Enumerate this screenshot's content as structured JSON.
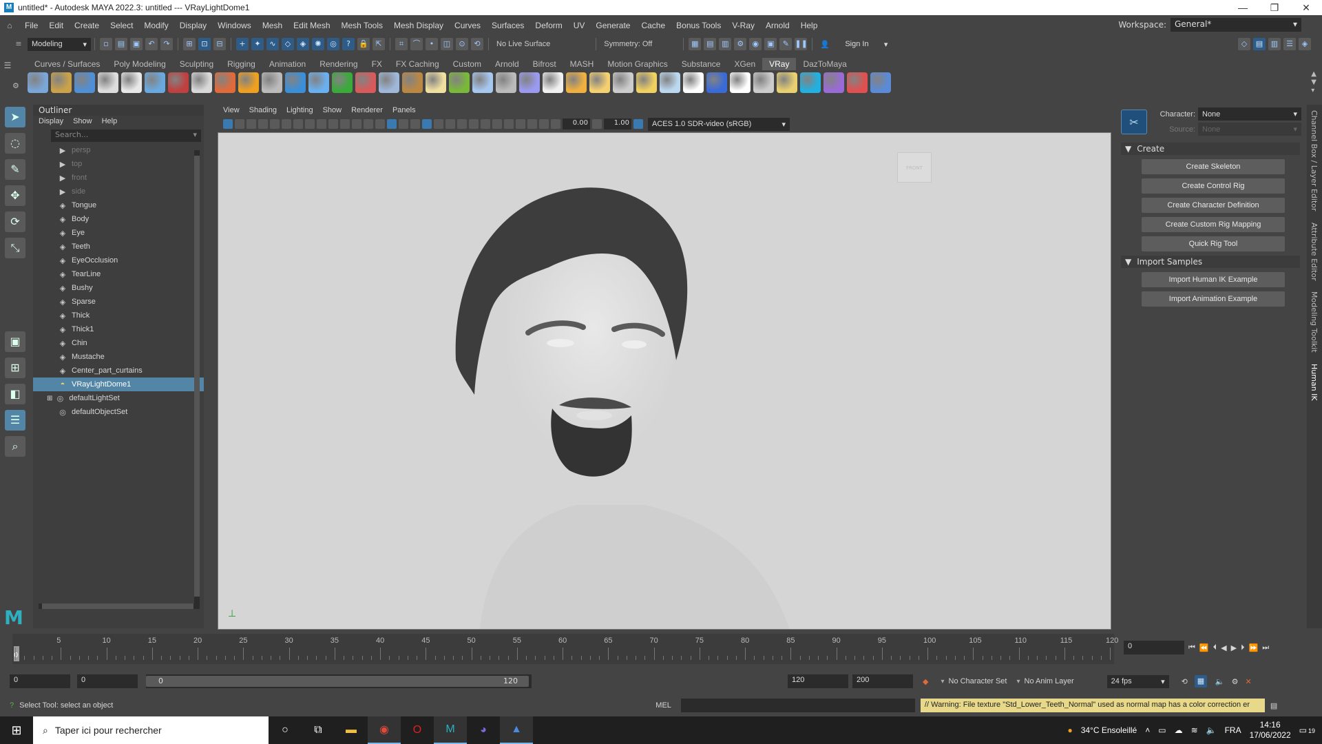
{
  "window": {
    "title": "untitled* - Autodesk MAYA 2022.3: untitled   ---   VRayLightDome1",
    "controls": [
      "—",
      "❐",
      "✕"
    ]
  },
  "menubar": {
    "items": [
      "File",
      "Edit",
      "Create",
      "Select",
      "Modify",
      "Display",
      "Windows",
      "Mesh",
      "Edit Mesh",
      "Mesh Tools",
      "Mesh Display",
      "Curves",
      "Surfaces",
      "Deform",
      "UV",
      "Generate",
      "Cache",
      "Bonus Tools",
      "V-Ray",
      "Arnold",
      "Help"
    ]
  },
  "workspace": {
    "label": "Workspace:",
    "value": "General*"
  },
  "statusline": {
    "mode": "Modeling",
    "live_surface": "No Live Surface",
    "symmetry": "Symmetry: Off",
    "sign_in": "Sign In"
  },
  "shelf": {
    "tabs": [
      "Curves / Surfaces",
      "Poly Modeling",
      "Sculpting",
      "Rigging",
      "Animation",
      "Rendering",
      "FX",
      "FX Caching",
      "Custom",
      "Arnold",
      "Bifrost",
      "MASH",
      "Motion Graphics",
      "Substance",
      "XGen",
      "VRay",
      "DazToMaya"
    ],
    "active_tab": "VRay",
    "icon_colors": [
      "#7aa6d8",
      "#c9a24a",
      "#4f8fd6",
      "#dddddd",
      "#e8e8e8",
      "#6aa9e0",
      "#c04040",
      "#d8d8d8",
      "#e06a3a",
      "#f0a020",
      "#bbbbbb",
      "#3b8fd8",
      "#6ab0f0",
      "#3aaa3a",
      "#d85a5a",
      "#9fb7d8",
      "#bb8844",
      "#f0e0a0",
      "#7ab83a",
      "#a6c8f0",
      "#bbbbbb",
      "#9a9af0",
      "#f0f0f0",
      "#f0b040",
      "#f5d070",
      "#cccccc",
      "#f0d060",
      "#bcd8f0",
      "#ffffff",
      "#3a6ad8",
      "#ffffff",
      "#cccccc",
      "#e8d070",
      "#22b0e0",
      "#9a6ad8",
      "#e05050",
      "#5a8ad8"
    ]
  },
  "outliner": {
    "title": "Outliner",
    "menu": [
      "Display",
      "Show",
      "Help"
    ],
    "search_placeholder": "Search...",
    "items": [
      {
        "label": "persp",
        "icon": "camera-icon",
        "dim": true
      },
      {
        "label": "top",
        "icon": "camera-icon",
        "dim": true
      },
      {
        "label": "front",
        "icon": "camera-icon",
        "dim": true
      },
      {
        "label": "side",
        "icon": "camera-icon",
        "dim": true
      },
      {
        "label": "Tongue",
        "icon": "mesh-icon"
      },
      {
        "label": "Body",
        "icon": "mesh-icon"
      },
      {
        "label": "Eye",
        "icon": "mesh-icon"
      },
      {
        "label": "Teeth",
        "icon": "mesh-icon"
      },
      {
        "label": "EyeOcclusion",
        "icon": "mesh-icon"
      },
      {
        "label": "TearLine",
        "icon": "mesh-icon"
      },
      {
        "label": "Bushy",
        "icon": "mesh-icon"
      },
      {
        "label": "Sparse",
        "icon": "mesh-icon"
      },
      {
        "label": "Thick",
        "icon": "mesh-icon"
      },
      {
        "label": "Thick1",
        "icon": "mesh-icon"
      },
      {
        "label": "Chin",
        "icon": "mesh-icon"
      },
      {
        "label": "Mustache",
        "icon": "mesh-icon"
      },
      {
        "label": "Center_part_curtains",
        "icon": "mesh-icon"
      },
      {
        "label": "VRayLightDome1",
        "icon": "dome-light-icon",
        "selected": true
      },
      {
        "label": "defaultLightSet",
        "icon": "set-icon"
      },
      {
        "label": "defaultObjectSet",
        "icon": "set-icon"
      }
    ]
  },
  "viewport": {
    "menu": [
      "View",
      "Shading",
      "Lighting",
      "Show",
      "Renderer",
      "Panels"
    ],
    "exposure": "0.00",
    "gamma": "1.00",
    "color_space": "ACES 1.0 SDR-video (sRGB)",
    "viewcube_label": "FRONT",
    "bg_color": "#d5d5d5"
  },
  "hik": {
    "character_label": "Character:",
    "character_value": "None",
    "source_label": "Source:",
    "source_value": "None",
    "create_section": "Create",
    "create_buttons": [
      "Create Skeleton",
      "Create Control Rig",
      "Create Character Definition",
      "Create Custom Rig Mapping",
      "Quick Rig Tool"
    ],
    "import_section": "Import Samples",
    "import_buttons": [
      "Import Human IK Example",
      "Import Animation Example"
    ]
  },
  "right_tabs": [
    "Channel Box / Layer Editor",
    "Attribute Editor",
    "Modeling Toolkit",
    "Human IK"
  ],
  "timeline": {
    "ticks": [
      5,
      10,
      15,
      20,
      25,
      30,
      35,
      40,
      45,
      50,
      55,
      60,
      65,
      70,
      75,
      80,
      85,
      90,
      95,
      100,
      105,
      110,
      115,
      120
    ],
    "current_frame": "0",
    "current_field": "0",
    "max": 120
  },
  "range": {
    "start": "0",
    "playback_start": "0",
    "slider_start": "0",
    "slider_end": "120",
    "playback_end": "120",
    "end": "200",
    "character_set": "No Character Set",
    "anim_layer": "No Anim Layer",
    "fps": "24 fps"
  },
  "cmdline": {
    "help": "Select Tool: select an object",
    "lang": "MEL",
    "warning": "// Warning: File texture \"Std_Lower_Teeth_Normal\" used as normal map has a color correction er"
  },
  "taskbar": {
    "search_placeholder": "Taper ici pour rechercher",
    "weather": "34°C  Ensoleillé",
    "language": "FRA",
    "time": "14:16",
    "date": "17/06/2022",
    "notifications": "19"
  }
}
